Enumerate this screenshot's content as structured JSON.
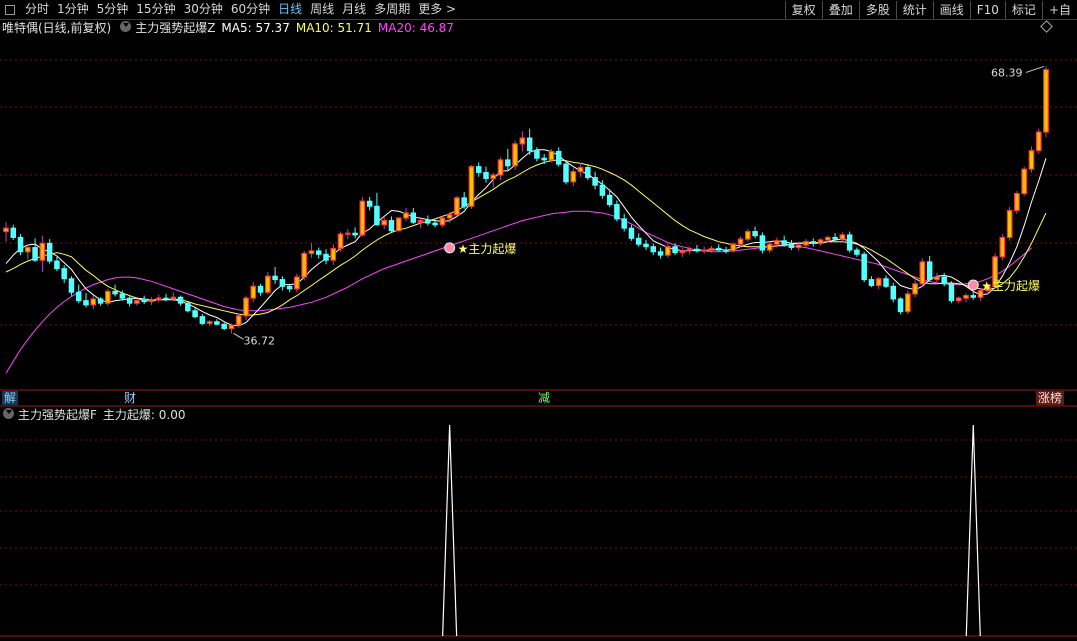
{
  "toolbar": {
    "periods": [
      {
        "label": "分时"
      },
      {
        "label": "1分钟"
      },
      {
        "label": "5分钟"
      },
      {
        "label": "15分钟"
      },
      {
        "label": "30分钟"
      },
      {
        "label": "60分钟"
      },
      {
        "label": "日线",
        "active": true
      },
      {
        "label": "周线"
      },
      {
        "label": "月线"
      },
      {
        "label": "多周期"
      },
      {
        "label": "更多 >"
      }
    ],
    "buttons": [
      {
        "label": "复权"
      },
      {
        "label": "叠加"
      },
      {
        "label": "多股"
      },
      {
        "label": "统计"
      },
      {
        "label": "画线"
      },
      {
        "label": "F10"
      },
      {
        "label": "标记"
      },
      {
        "label": "+自"
      }
    ]
  },
  "main_legend": {
    "stock": "唯特偶(日线,前复权)",
    "formula": "主力强势起爆Z",
    "ma5": "MA5: 57.37",
    "ma10": "MA10: 51.71",
    "ma20": "MA20: 46.87"
  },
  "indicator_legend": {
    "formula": "主力强势起爆F",
    "value": "主力起爆: 0.00"
  },
  "flags": {
    "jie": "解",
    "cai": "财",
    "jian": "减",
    "zhangting": "涨榜"
  },
  "colors": {
    "up": "#ff3a3a",
    "up_fill": "#ffc000",
    "down": "#54ffff",
    "ma5": "#ffffff",
    "ma10": "#ffff55",
    "ma20": "#ff44ff",
    "grid": "#7a1010",
    "signal": "#ffff66",
    "active": "#5ec8ff"
  },
  "chart_data": {
    "type": "candlestick",
    "price_range": [
      30,
      72
    ],
    "indicator_range": [
      0,
      1
    ],
    "annotations": {
      "max_label": "68.39",
      "min_label": "36.72",
      "signal_label": "★主力起爆"
    },
    "candles": [
      [
        48.8,
        49.9,
        47.6,
        49.2
      ],
      [
        49.2,
        49.6,
        47.8,
        48.1
      ],
      [
        48.1,
        48.5,
        46.0,
        46.4
      ],
      [
        46.4,
        47.2,
        45.5,
        46.9
      ],
      [
        46.9,
        48.0,
        45.2,
        45.4
      ],
      [
        45.4,
        48.3,
        44.0,
        47.4
      ],
      [
        47.4,
        47.9,
        45.0,
        45.3
      ],
      [
        45.3,
        45.8,
        44.1,
        44.4
      ],
      [
        44.4,
        44.8,
        42.7,
        43.2
      ],
      [
        43.2,
        43.5,
        41.2,
        41.6
      ],
      [
        41.6,
        42.5,
        40.3,
        40.6
      ],
      [
        40.6,
        41.5,
        39.8,
        40.1
      ],
      [
        40.1,
        41.2,
        39.6,
        40.8
      ],
      [
        40.8,
        41.0,
        40.0,
        40.3
      ],
      [
        40.3,
        42.0,
        40.0,
        41.7
      ],
      [
        41.7,
        42.5,
        41.1,
        41.4
      ],
      [
        41.4,
        41.8,
        40.6,
        40.9
      ],
      [
        40.9,
        41.1,
        39.9,
        40.3
      ],
      [
        40.3,
        40.8,
        40.0,
        40.6
      ],
      [
        40.6,
        41.2,
        40.2,
        40.5
      ],
      [
        40.5,
        41.0,
        40.1,
        40.7
      ],
      [
        40.7,
        41.3,
        40.4,
        40.9
      ],
      [
        40.9,
        41.4,
        40.5,
        40.8
      ],
      [
        40.8,
        41.6,
        40.5,
        41.0
      ],
      [
        41.0,
        41.2,
        40.0,
        40.3
      ],
      [
        40.3,
        40.5,
        39.2,
        39.4
      ],
      [
        39.4,
        39.9,
        38.5,
        38.7
      ],
      [
        38.7,
        39.0,
        37.7,
        37.9
      ],
      [
        37.9,
        38.3,
        37.6,
        38.1
      ],
      [
        38.1,
        38.4,
        37.7,
        37.8
      ],
      [
        37.8,
        38.0,
        37.1,
        37.3
      ],
      [
        37.3,
        37.9,
        36.72,
        37.7
      ],
      [
        37.7,
        39.0,
        37.4,
        38.8
      ],
      [
        38.8,
        41.2,
        38.3,
        40.9
      ],
      [
        40.9,
        42.8,
        40.4,
        42.3
      ],
      [
        42.3,
        42.6,
        41.2,
        41.6
      ],
      [
        41.6,
        44.0,
        41.4,
        43.5
      ],
      [
        43.5,
        44.6,
        42.6,
        43.1
      ],
      [
        43.1,
        43.5,
        41.8,
        42.3
      ],
      [
        42.3,
        42.6,
        41.6,
        42.0
      ],
      [
        42.0,
        43.8,
        41.6,
        43.4
      ],
      [
        43.4,
        46.5,
        43.0,
        46.2
      ],
      [
        46.2,
        47.4,
        45.7,
        46.5
      ],
      [
        46.5,
        46.9,
        45.6,
        46.1
      ],
      [
        46.1,
        46.7,
        44.9,
        45.4
      ],
      [
        45.4,
        47.3,
        44.8,
        46.8
      ],
      [
        46.8,
        48.8,
        46.4,
        48.5
      ],
      [
        48.5,
        49.1,
        47.9,
        48.6
      ],
      [
        48.6,
        49.3,
        48.0,
        48.4
      ],
      [
        48.4,
        52.9,
        48.2,
        52.4
      ],
      [
        52.4,
        52.9,
        51.3,
        51.8
      ],
      [
        51.8,
        53.4,
        49.5,
        49.6
      ],
      [
        49.6,
        50.5,
        49.1,
        50.1
      ],
      [
        50.1,
        50.6,
        48.6,
        48.9
      ],
      [
        48.9,
        50.5,
        48.8,
        50.4
      ],
      [
        50.4,
        51.6,
        50.0,
        51.0
      ],
      [
        51.0,
        51.6,
        49.7,
        49.9
      ],
      [
        49.9,
        50.4,
        49.2,
        50.1
      ],
      [
        50.1,
        50.7,
        49.5,
        49.8
      ],
      [
        49.8,
        50.2,
        49.3,
        49.6
      ],
      [
        49.6,
        50.7,
        49.3,
        50.4
      ],
      [
        50.4,
        51.1,
        49.8,
        50.8
      ],
      [
        50.8,
        53.0,
        50.6,
        52.8
      ],
      [
        52.8,
        53.5,
        51.5,
        51.8
      ],
      [
        51.8,
        56.7,
        51.5,
        56.5
      ],
      [
        56.5,
        57.0,
        55.3,
        55.8
      ],
      [
        55.8,
        56.5,
        54.6,
        55.1
      ],
      [
        55.1,
        55.8,
        54.0,
        55.5
      ],
      [
        55.5,
        57.6,
        54.9,
        57.3
      ],
      [
        57.3,
        58.6,
        56.1,
        56.6
      ],
      [
        56.6,
        59.6,
        56.1,
        59.2
      ],
      [
        59.2,
        60.7,
        58.3,
        59.9
      ],
      [
        59.9,
        61.0,
        57.9,
        58.4
      ],
      [
        58.4,
        58.8,
        57.1,
        57.5
      ],
      [
        57.5,
        58.0,
        56.8,
        57.3
      ],
      [
        57.3,
        58.6,
        57.0,
        58.3
      ],
      [
        58.3,
        58.8,
        56.5,
        56.8
      ],
      [
        56.8,
        57.1,
        54.4,
        54.7
      ],
      [
        54.7,
        56.3,
        54.2,
        55.9
      ],
      [
        55.9,
        57.0,
        55.3,
        56.4
      ],
      [
        56.4,
        56.8,
        54.9,
        55.2
      ],
      [
        55.2,
        55.9,
        53.8,
        54.3
      ],
      [
        54.3,
        54.9,
        52.7,
        53.1
      ],
      [
        53.1,
        53.8,
        51.7,
        52.0
      ],
      [
        52.0,
        52.5,
        50.0,
        50.3
      ],
      [
        50.3,
        50.9,
        48.8,
        49.2
      ],
      [
        49.2,
        49.6,
        47.7,
        48.0
      ],
      [
        48.0,
        48.6,
        47.0,
        47.3
      ],
      [
        47.3,
        47.8,
        46.6,
        47.0
      ],
      [
        47.0,
        47.4,
        46.0,
        46.4
      ],
      [
        46.4,
        46.9,
        45.6,
        46.0
      ],
      [
        46.0,
        47.4,
        45.7,
        47.0
      ],
      [
        47.0,
        47.4,
        46.0,
        46.3
      ],
      [
        46.3,
        46.8,
        45.8,
        46.5
      ],
      [
        46.5,
        47.0,
        46.1,
        46.7
      ],
      [
        46.7,
        47.2,
        46.3,
        46.5
      ],
      [
        46.5,
        47.0,
        46.2,
        46.6
      ],
      [
        46.6,
        47.1,
        46.3,
        46.8
      ],
      [
        46.8,
        47.3,
        46.4,
        46.6
      ],
      [
        46.6,
        47.0,
        46.2,
        46.5
      ],
      [
        46.5,
        47.5,
        46.3,
        47.3
      ],
      [
        47.3,
        48.2,
        47.0,
        47.9
      ],
      [
        47.9,
        49.1,
        47.6,
        48.8
      ],
      [
        48.8,
        49.4,
        48.0,
        48.3
      ],
      [
        48.3,
        48.7,
        46.2,
        46.6
      ],
      [
        46.6,
        47.6,
        46.3,
        47.3
      ],
      [
        47.3,
        48.1,
        46.9,
        47.7
      ],
      [
        47.7,
        48.3,
        47.0,
        47.3
      ],
      [
        47.3,
        47.8,
        46.6,
        46.9
      ],
      [
        46.9,
        47.6,
        46.5,
        47.2
      ],
      [
        47.2,
        47.9,
        46.9,
        47.6
      ],
      [
        47.6,
        48.0,
        47.0,
        47.4
      ],
      [
        47.4,
        48.0,
        47.1,
        47.8
      ],
      [
        47.8,
        48.3,
        47.5,
        48.1
      ],
      [
        48.1,
        48.6,
        47.7,
        47.9
      ],
      [
        47.9,
        48.7,
        47.6,
        48.4
      ],
      [
        48.4,
        48.8,
        46.3,
        46.6
      ],
      [
        46.6,
        46.9,
        45.8,
        46.1
      ],
      [
        46.1,
        46.4,
        42.8,
        43.1
      ],
      [
        43.1,
        43.5,
        42.2,
        42.4
      ],
      [
        42.4,
        43.4,
        42.0,
        43.2
      ],
      [
        43.2,
        43.6,
        42.1,
        42.3
      ],
      [
        42.3,
        42.7,
        40.4,
        40.8
      ],
      [
        40.8,
        41.0,
        39.0,
        39.3
      ],
      [
        39.3,
        41.8,
        39.0,
        41.4
      ],
      [
        41.4,
        43.0,
        41.0,
        42.6
      ],
      [
        42.6,
        45.6,
        42.2,
        45.2
      ],
      [
        45.2,
        45.9,
        42.8,
        43.1
      ],
      [
        43.1,
        43.9,
        42.5,
        43.4
      ],
      [
        43.4,
        43.9,
        42.3,
        42.6
      ],
      [
        42.6,
        42.9,
        40.3,
        40.6
      ],
      [
        40.6,
        41.1,
        40.3,
        40.9
      ],
      [
        40.9,
        41.5,
        40.4,
        41.2
      ],
      [
        41.2,
        41.6,
        40.7,
        41.0
      ],
      [
        41.0,
        42.1,
        40.6,
        41.8
      ],
      [
        41.8,
        42.6,
        41.4,
        42.3
      ],
      [
        42.3,
        46.2,
        42.0,
        45.8
      ],
      [
        45.8,
        48.5,
        45.4,
        48.1
      ],
      [
        48.1,
        51.7,
        47.7,
        51.3
      ],
      [
        51.3,
        53.6,
        50.9,
        53.3
      ],
      [
        53.3,
        56.5,
        53.0,
        56.2
      ],
      [
        56.2,
        58.9,
        55.8,
        58.4
      ],
      [
        58.4,
        61.0,
        58.0,
        60.6
      ],
      [
        60.6,
        68.39,
        60.0,
        68.0
      ]
    ],
    "ma5": [
      45.0,
      46.0,
      46.8,
      47.2,
      47.3,
      46.7,
      46.4,
      45.9,
      45.1,
      44.3,
      43.1,
      42.0,
      41.3,
      40.7,
      40.4,
      40.6,
      40.7,
      40.8,
      40.9,
      40.8,
      40.7,
      40.7,
      40.7,
      40.7,
      40.6,
      40.2,
      39.8,
      39.3,
      38.9,
      38.6,
      38.1,
      37.7,
      37.6,
      38.0,
      38.9,
      39.8,
      40.8,
      41.8,
      42.5,
      42.5,
      42.6,
      43.4,
      44.3,
      45.0,
      45.6,
      46.1,
      46.8,
      47.2,
      47.6,
      48.6,
      49.1,
      49.9,
      50.6,
      51.3,
      51.2,
      50.9,
      50.5,
      50.4,
      50.2,
      50.1,
      50.0,
      50.1,
      50.6,
      51.2,
      52.3,
      53.2,
      54.0,
      55.0,
      56.0,
      56.0,
      56.7,
      57.5,
      58.2,
      58.5,
      58.5,
      58.3,
      57.8,
      57.1,
      56.5,
      56.0,
      55.6,
      55.0,
      54.4,
      53.7,
      52.9,
      51.7,
      50.5,
      49.5,
      48.6,
      47.7,
      47.3,
      46.9,
      46.7,
      46.5,
      46.5,
      46.6,
      46.6,
      46.6,
      46.7,
      46.6,
      46.7,
      47.0,
      47.3,
      47.5,
      47.5,
      47.6,
      47.7,
      47.6,
      47.4,
      47.4,
      47.4,
      47.4,
      47.4,
      47.6,
      47.8,
      47.9,
      47.7,
      47.4,
      46.8,
      46.0,
      45.2,
      44.1,
      43.2,
      42.4,
      42.1,
      41.9,
      42.3,
      43.1,
      43.5,
      43.6,
      43.4,
      42.9,
      42.3,
      41.7,
      41.3,
      41.4,
      42.2,
      43.5,
      45.1,
      47.0,
      49.5,
      52.3,
      54.8,
      57.5
    ],
    "ma10": [
      44.0,
      44.4,
      44.9,
      45.3,
      45.6,
      45.9,
      46.1,
      46.3,
      46.1,
      45.8,
      45.0,
      44.2,
      43.6,
      42.9,
      42.3,
      41.9,
      41.5,
      41.2,
      40.9,
      40.6,
      40.6,
      40.7,
      40.7,
      40.8,
      40.7,
      40.5,
      40.2,
      40.0,
      39.8,
      39.6,
      39.4,
      39.2,
      39.0,
      38.9,
      38.9,
      39.0,
      39.2,
      39.6,
      40.1,
      40.7,
      41.2,
      41.8,
      42.4,
      43.0,
      43.6,
      44.2,
      44.8,
      45.3,
      45.9,
      46.6,
      47.2,
      47.8,
      48.3,
      48.7,
      49.0,
      49.2,
      49.5,
      49.8,
      50.0,
      50.3,
      50.6,
      50.9,
      51.3,
      51.8,
      52.3,
      52.8,
      53.3,
      53.8,
      54.4,
      54.9,
      55.3,
      55.8,
      56.3,
      56.7,
      57.0,
      57.2,
      57.3,
      57.2,
      57.0,
      56.9,
      56.7,
      56.5,
      56.2,
      55.8,
      55.4,
      54.9,
      54.3,
      53.6,
      52.9,
      52.2,
      51.5,
      50.8,
      50.1,
      49.5,
      49.0,
      48.6,
      48.2,
      47.9,
      47.6,
      47.4,
      47.2,
      47.1,
      47.0,
      47.0,
      47.0,
      47.0,
      47.1,
      47.2,
      47.3,
      47.4,
      47.5,
      47.5,
      47.5,
      47.6,
      47.6,
      47.6,
      47.5,
      47.3,
      47.0,
      46.6,
      46.1,
      45.6,
      45.0,
      44.4,
      43.8,
      43.2,
      42.8,
      42.6,
      42.6,
      42.7,
      42.7,
      42.6,
      42.4,
      42.2,
      42.0,
      41.9,
      42.1,
      42.6,
      43.3,
      44.4,
      45.8,
      47.4,
      49.2,
      51.0
    ],
    "ma20": [
      32.0,
      33.4,
      34.8,
      36.0,
      37.1,
      38.1,
      39.0,
      39.8,
      40.5,
      41.1,
      41.6,
      42.1,
      42.5,
      42.8,
      43.1,
      43.3,
      43.4,
      43.4,
      43.3,
      43.1,
      42.9,
      42.6,
      42.3,
      42.0,
      41.7,
      41.4,
      41.1,
      40.8,
      40.5,
      40.2,
      39.9,
      39.7,
      39.5,
      39.4,
      39.4,
      39.4,
      39.5,
      39.6,
      39.7,
      39.8,
      40.0,
      40.2,
      40.4,
      40.7,
      41.0,
      41.4,
      41.8,
      42.2,
      42.7,
      43.2,
      43.6,
      44.0,
      44.4,
      44.7,
      45.0,
      45.3,
      45.6,
      45.9,
      46.2,
      46.5,
      46.8,
      47.1,
      47.4,
      47.7,
      48.0,
      48.3,
      48.6,
      48.9,
      49.2,
      49.5,
      49.8,
      50.1,
      50.3,
      50.5,
      50.7,
      50.9,
      51.0,
      51.1,
      51.2,
      51.2,
      51.2,
      51.1,
      51.0,
      50.8,
      50.5,
      50.1,
      49.7,
      49.2,
      48.7,
      48.3,
      47.9,
      47.5,
      47.2,
      47.0,
      46.8,
      46.6,
      46.5,
      46.4,
      46.4,
      46.4,
      46.5,
      46.6,
      46.7,
      46.8,
      46.9,
      47.0,
      47.1,
      47.1,
      47.1,
      47.0,
      46.9,
      46.7,
      46.5,
      46.3,
      46.1,
      45.9,
      45.7,
      45.5,
      45.3,
      45.1,
      44.9,
      44.6,
      44.3,
      44.0,
      43.7,
      43.4,
      43.1,
      42.9,
      42.7,
      42.6,
      42.5,
      42.5,
      42.6,
      42.7,
      42.9,
      43.2,
      43.6,
      44.1,
      44.7,
      45.4,
      46.1,
      46.87
    ],
    "signals": [
      {
        "index": 61,
        "value": 1
      },
      {
        "index": 133,
        "value": 1
      }
    ]
  }
}
